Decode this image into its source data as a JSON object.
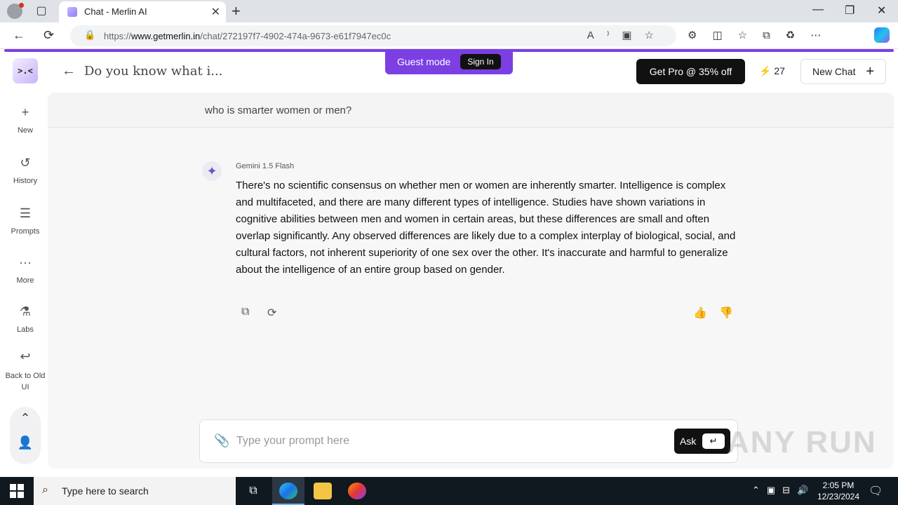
{
  "browser": {
    "tab_title": "Chat - Merlin AI",
    "url_prefix": "https://",
    "url_domain": "www.getmerlin.in",
    "url_path": "/chat/272197f7-4902-474a-9673-e61f7947ec0c"
  },
  "banner": {
    "guest_label": "Guest mode",
    "signin_label": "Sign In"
  },
  "header": {
    "logo_text": ">.<",
    "title": "Do you know what i...",
    "get_pro_label": "Get Pro @ 35% off",
    "credits": "27",
    "new_chat_label": "New Chat"
  },
  "sidebar": {
    "items": [
      {
        "label": "New",
        "icon": "plus-icon"
      },
      {
        "label": "History",
        "icon": "history-icon"
      },
      {
        "label": "Prompts",
        "icon": "prompts-icon"
      },
      {
        "label": "More",
        "icon": "more-icon"
      },
      {
        "label": "Labs",
        "icon": "flask-icon"
      },
      {
        "label": "Back to Old UI",
        "icon": "undo-icon"
      }
    ]
  },
  "conversation": {
    "user_message": "who is smarter women or men?",
    "model_name": "Gemini 1.5 Flash",
    "answer": "There's no scientific consensus on whether men or women are inherently smarter. Intelligence is complex and multifaceted, and there are many different types of intelligence. Studies have shown variations in cognitive abilities between men and women in certain areas, but these differences are small and often overlap significantly. Any observed differences are likely due to a complex interplay of biological, social, and cultural factors, not inherent superiority of one sex over the other. It's inaccurate and harmful to generalize about the intelligence of an entire group based on gender."
  },
  "composer": {
    "placeholder": "Type your prompt here",
    "ask_label": "Ask",
    "enter_key": "↵"
  },
  "watermark": "ANY RUN",
  "taskbar": {
    "search_placeholder": "Type here to search",
    "time": "2:05 PM",
    "date": "12/23/2024"
  },
  "colors": {
    "accent": "#7b3fe4",
    "dark_button": "#111111"
  }
}
